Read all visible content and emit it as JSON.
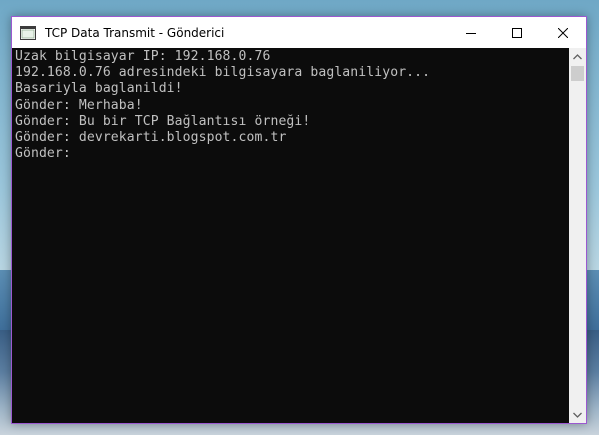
{
  "window": {
    "title": "TCP Data Transmit - Gönderici",
    "icon": "console-window-icon",
    "caption_buttons": [
      "minimize-icon",
      "maximize-icon",
      "close-icon"
    ]
  },
  "console": {
    "lines": [
      "Uzak bilgisayar IP: 192.168.0.76",
      "192.168.0.76 adresindeki bilgisayara baglaniliyor...",
      "Basariyla baglanildi!",
      "Gönder: Merhaba!",
      "Gönder: Bu bir TCP Bağlantısı örneği!",
      "Gönder: devrekarti.blogspot.com.tr",
      "Gönder:"
    ],
    "background": "#0c0c0c",
    "text_color": "#c0c0c0"
  },
  "colors": {
    "window_border": "#9b59d0"
  }
}
